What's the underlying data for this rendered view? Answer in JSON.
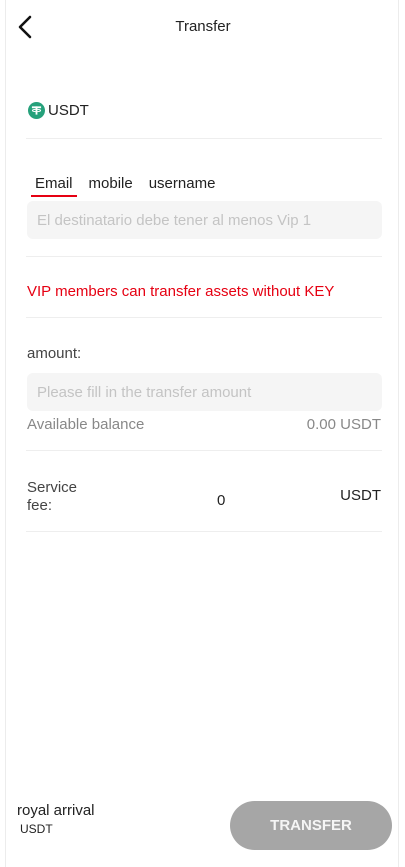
{
  "header": {
    "title": "Transfer"
  },
  "asset": {
    "label": "USDT"
  },
  "recipient": {
    "tabs": [
      {
        "label": "Email",
        "active": true
      },
      {
        "label": "mobile",
        "active": false
      },
      {
        "label": "username",
        "active": false
      }
    ],
    "placeholder": "El destinatario debe tener al menos Vip 1",
    "value": ""
  },
  "notice": {
    "text": "VIP members can transfer assets without KEY"
  },
  "amount": {
    "label": "amount:",
    "placeholder": "Please fill in the transfer amount",
    "value": "",
    "balance_label": "Available balance",
    "balance_value": "0.00 USDT"
  },
  "fee": {
    "label": "Service fee:",
    "value": "0",
    "unit": "USDT"
  },
  "footer": {
    "arrival_label": "royal arrival",
    "arrival_unit": "USDT",
    "button_label": "TRANSFER"
  },
  "colors": {
    "accent": "#e60012",
    "coin": "#26a17b",
    "button_disabled": "#a6a6a6"
  }
}
